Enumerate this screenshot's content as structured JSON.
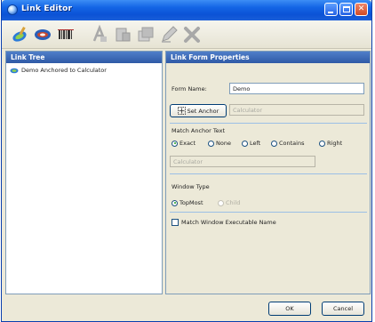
{
  "window": {
    "title": "Link Editor"
  },
  "toolbar": {
    "icons": [
      "link-new-icon",
      "link-open-icon",
      "barcode-icon",
      "anchor-text-icon",
      "form-icon",
      "stack-icon",
      "pen-icon",
      "delete-icon"
    ]
  },
  "tree": {
    "header": "Link Tree",
    "items": [
      {
        "label": "Demo Anchored to Calculator"
      }
    ]
  },
  "form": {
    "header": "Link Form Properties",
    "form_name_label": "Form Name:",
    "form_name_value": "Demo",
    "set_anchor_label": "Set Anchor",
    "anchor_value": "Calculator",
    "match_anchor_label": "Match Anchor Text",
    "match_options": [
      "Exact",
      "None",
      "Left",
      "Contains",
      "Right"
    ],
    "match_selected": "Exact",
    "match_text_value": "Calculator",
    "window_type_label": "Window Type",
    "window_type_options": [
      "TopMost",
      "Child"
    ],
    "window_type_selected": "TopMost",
    "match_exe_label": "Match Window Executable Name"
  },
  "buttons": {
    "ok": "OK",
    "cancel": "Cancel"
  },
  "colors": {
    "title_bar": "#0b52d6",
    "pane_header": "#2f5aa6",
    "accent_green": "#21a121"
  }
}
